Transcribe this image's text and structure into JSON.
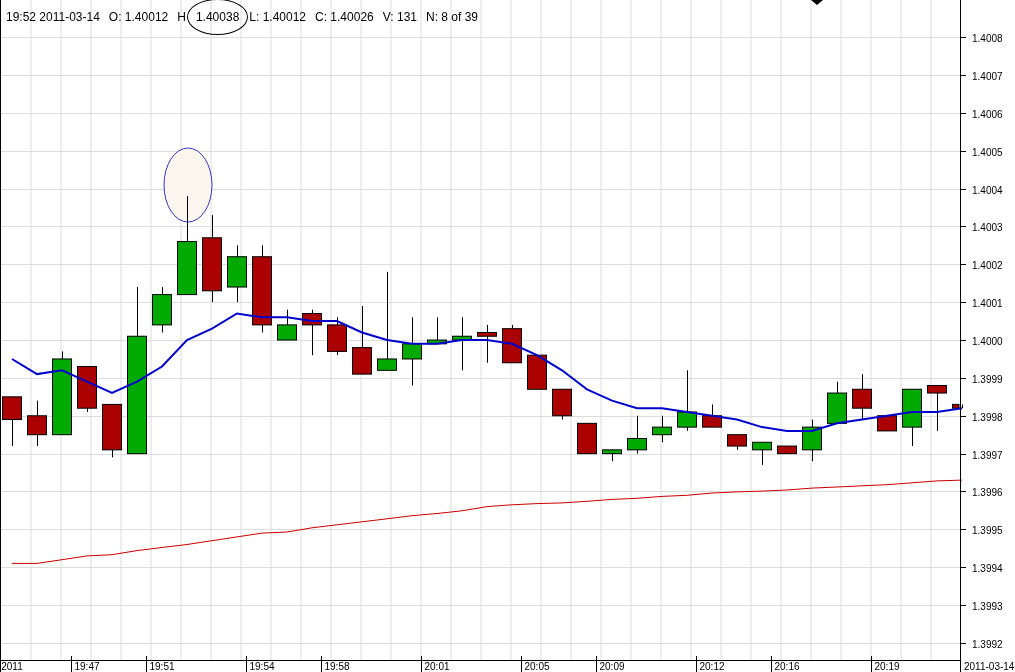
{
  "header": [
    {
      "text": "19:52 2011-03-14",
      "circled": false
    },
    {
      "text": "O: 1.40012",
      "circled": false
    },
    {
      "text": "H",
      "circled": false
    },
    {
      "text": "1.40038",
      "circled": true
    },
    {
      "text": "L: 1.40012",
      "circled": false
    },
    {
      "text": "C: 1.40026",
      "circled": false
    },
    {
      "text": "V: 131",
      "circled": false
    },
    {
      "text": "N: 8 of 39",
      "circled": false
    }
  ],
  "chart_data": {
    "type": "candlestick",
    "grid": true,
    "categories": [
      "2011",
      null,
      null,
      "19:47",
      null,
      null,
      "19:51",
      null,
      null,
      null,
      "19:54",
      null,
      null,
      "19:58",
      null,
      null,
      null,
      "20:01",
      null,
      null,
      null,
      "20:05",
      null,
      null,
      "20:09",
      null,
      null,
      null,
      "20:12",
      null,
      null,
      "20:16",
      null,
      null,
      null,
      "20:19",
      null,
      null,
      null
    ],
    "ylim": [
      1.399155,
      1.400898
    ],
    "series": [
      {
        "ohlc": [
          [
            1.39985,
            1.39985,
            1.39972,
            1.39979
          ],
          [
            1.3998,
            1.39984,
            1.39972,
            1.39975
          ],
          [
            1.39975,
            1.39997,
            1.39975,
            1.39995
          ],
          [
            1.39993,
            1.39993,
            1.39981,
            1.39982
          ],
          [
            1.39983,
            1.39983,
            1.39969,
            1.39971
          ],
          [
            1.3997,
            1.40014,
            1.3997,
            1.40001
          ],
          [
            1.40004,
            1.40014,
            1.40002,
            1.40012
          ],
          [
            1.40012,
            1.40038,
            1.40012,
            1.40026
          ],
          [
            1.40027,
            1.40033,
            1.4001,
            1.40013
          ],
          [
            1.40014,
            1.40025,
            1.4001,
            1.40022
          ],
          [
            1.40022,
            1.40025,
            1.40002,
            1.40004
          ],
          [
            1.4,
            1.40008,
            1.4,
            1.40004
          ],
          [
            1.40007,
            1.40008,
            1.39996,
            1.40004
          ],
          [
            1.40004,
            1.40006,
            1.39996,
            1.39997
          ],
          [
            1.39998,
            1.40009,
            1.39991,
            1.39991
          ],
          [
            1.39992,
            1.40018,
            1.39992,
            1.39995
          ],
          [
            1.39995,
            1.40006,
            1.39988,
            1.39999
          ],
          [
            1.39999,
            1.40006,
            1.39999,
            1.4
          ],
          [
            1.4,
            1.40006,
            1.39992,
            1.40001
          ],
          [
            1.40002,
            1.40004,
            1.39994,
            1.40001
          ],
          [
            1.40003,
            1.40004,
            1.39994,
            1.39994
          ],
          [
            1.39996,
            1.39996,
            1.39987,
            1.39987
          ],
          [
            1.39987,
            1.39987,
            1.39979,
            1.3998
          ],
          [
            1.39978,
            1.39978,
            1.3997,
            1.3997
          ],
          [
            1.3997,
            1.39971,
            1.39968,
            1.39971
          ],
          [
            1.39971,
            1.3998,
            1.3997,
            1.39974
          ],
          [
            1.39975,
            1.3998,
            1.39973,
            1.39977
          ],
          [
            1.39977,
            1.39992,
            1.39976,
            1.39981
          ],
          [
            1.3998,
            1.39983,
            1.39977,
            1.39977
          ],
          [
            1.39975,
            1.39975,
            1.39971,
            1.39972
          ],
          [
            1.39971,
            1.39973,
            1.39967,
            1.39973
          ],
          [
            1.39972,
            1.39972,
            1.3997,
            1.3997
          ],
          [
            1.39971,
            1.39979,
            1.39968,
            1.39977
          ],
          [
            1.39978,
            1.39989,
            1.39978,
            1.39986
          ],
          [
            1.39987,
            1.39991,
            1.39979,
            1.39982
          ],
          [
            1.3998,
            1.3998,
            1.39976,
            1.39976
          ],
          [
            1.39977,
            1.39987,
            1.39972,
            1.39987
          ],
          [
            1.39988,
            1.39988,
            1.39976,
            1.39986
          ],
          [
            1.39983,
            1.39983,
            1.39982,
            1.39982
          ]
        ]
      },
      {
        "type": "line",
        "color": "#0000cc",
        "values": [
          1.39995,
          1.39991,
          1.39992,
          1.39989,
          1.39986,
          1.39989,
          1.39993,
          1.4,
          1.40003,
          1.40007,
          1.40006,
          1.40006,
          1.40005,
          1.40005,
          1.40002,
          1.4,
          1.39999,
          1.39999,
          1.4,
          1.4,
          1.39999,
          1.39996,
          1.39992,
          1.39987,
          1.39984,
          1.39982,
          1.39982,
          1.39981,
          1.3998,
          1.39979,
          1.39977,
          1.39976,
          1.39976,
          1.39978,
          1.39979,
          1.3998,
          1.39981,
          1.39981,
          1.39982
        ]
      },
      {
        "type": "line",
        "color": "#cc0000",
        "values": [
          1.39941,
          1.39941,
          1.39942,
          1.39943,
          1.399433,
          1.399444,
          1.399452,
          1.39946,
          1.39947,
          1.39948,
          1.39949,
          1.399493,
          1.399504,
          1.399512,
          1.39952,
          1.399528,
          1.399536,
          1.399542,
          1.399549,
          1.39956,
          1.399565,
          1.399568,
          1.39957,
          1.399574,
          1.399579,
          1.399582,
          1.399587,
          1.39959,
          1.399596,
          1.399599,
          1.399601,
          1.399604,
          1.399609,
          1.399612,
          1.399615,
          1.399618,
          1.399623,
          1.399628,
          1.39963
        ]
      }
    ],
    "yticks": [
      {
        "value": 1.4008,
        "label": "1.4008"
      },
      {
        "value": 1.4007,
        "label": "1.4007"
      },
      {
        "value": 1.4006,
        "label": "1.4006"
      },
      {
        "value": 1.4005,
        "label": "1.4005"
      },
      {
        "value": 1.4004,
        "label": "1.4004"
      },
      {
        "value": 1.4003,
        "label": "1.4003"
      },
      {
        "value": 1.4002,
        "label": "1.4002"
      },
      {
        "value": 1.4001,
        "label": "1.4001"
      },
      {
        "value": 1.4,
        "label": "1.4000"
      },
      {
        "value": 1.3999,
        "label": "1.3999"
      },
      {
        "value": 1.3998,
        "label": "1.3998"
      },
      {
        "value": 1.3997,
        "label": "1.3997"
      },
      {
        "value": 1.3996,
        "label": "1.3996"
      },
      {
        "value": 1.3995,
        "label": "1.3995"
      },
      {
        "value": 1.3994,
        "label": "1.3994"
      },
      {
        "value": 1.3993,
        "label": "1.3993"
      },
      {
        "value": 1.3992,
        "label": "1.3992"
      }
    ]
  },
  "date_label": "2011-03-14"
}
